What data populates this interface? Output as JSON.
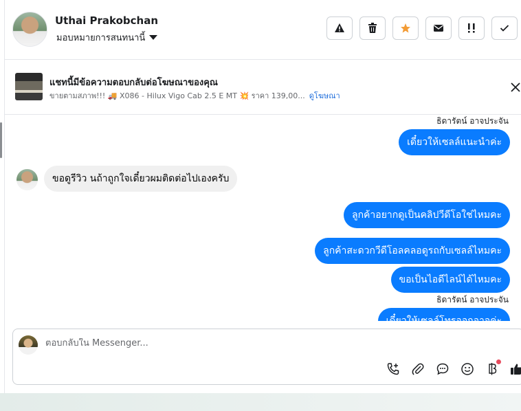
{
  "header": {
    "user_name": "Uthai Prakobchan",
    "assign_label": "มอบหมายการสนทนานี้"
  },
  "header_actions": [
    "warning-icon",
    "trash-icon",
    "star-icon",
    "envelope-icon",
    "priority-icon",
    "check-icon"
  ],
  "ad": {
    "title": "แชทนี้มีข้อความตอบกลับต่อโฆษณาของคุณ",
    "subtitle": "ขายตามสภาพ!!! 🚚 X086 - Hilux Vigo Cab 2.5 E MT 💥 ราคา 139,00...",
    "link": "ดูโฆษณา"
  },
  "messages": {
    "sender_1": "ธิดารัตน์ อาจประจัน",
    "out_1": "เดี๋ยวให้เซลล์แนะนำค่ะ",
    "in_1": "ขอดูรีวิว นถ้าถูกใจเดี๋ยวผมติดต่อไปเองครับ",
    "out_2": "ลูกค้าอยากดูเป็นคลิปวีดีโอใช่ไหมคะ",
    "out_3": "ลูกค้าสะดวกวีดีโอลคลอดูรถกับเซลล์ไหมคะ",
    "out_4": "ขอเป็นไอดีไลน์ได้ไหมคะ",
    "sender_2": "ธิดารัตน์ อาจประจัน",
    "out_5": "เดี๋ยวให้เซลล์โทรออกอาจค่ะ"
  },
  "composer": {
    "placeholder": "ตอบกลับใน Messenger..."
  },
  "colors": {
    "outgoing_bubble": "#0a7cff",
    "incoming_bubble": "#f0f0f0",
    "accent_star": "#f39c36"
  }
}
